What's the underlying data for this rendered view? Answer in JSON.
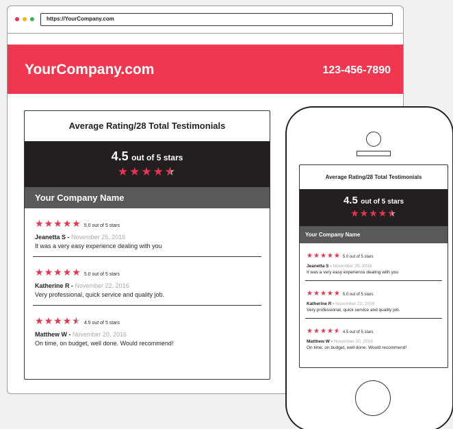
{
  "browser": {
    "url": "https://YourCompany.com",
    "dot_colors": [
      "#e8344e",
      "#f7b500",
      "#39b54a"
    ]
  },
  "site": {
    "brand": "YourCompany.com",
    "phone": "123-456-7890",
    "accent_color": "#ef3850"
  },
  "widget": {
    "title": "Average Rating/28 Total Testimonials",
    "score": "4.5",
    "score_suffix": "out of 5 stars",
    "overall_stars": 4.5,
    "company_name": "Your Company Name",
    "reviews": [
      {
        "stars": 5.0,
        "rating_text": "5.0 out of 5 stars",
        "name": "Jeanetta S -",
        "date": "November 25, 2016",
        "text": "It was a very easy experience dealing with you"
      },
      {
        "stars": 5.0,
        "rating_text": "5.0 out of 5 stars",
        "name": "Katherine R -",
        "date": "November 22, 2016",
        "text": "Very professional, quick service and quality job."
      },
      {
        "stars": 4.5,
        "rating_text": "4.5 out of 5 stars",
        "name": "Matthew W -",
        "date": "November 20, 2016",
        "text": "On time, on budget, well done. Would recommend!"
      }
    ]
  }
}
